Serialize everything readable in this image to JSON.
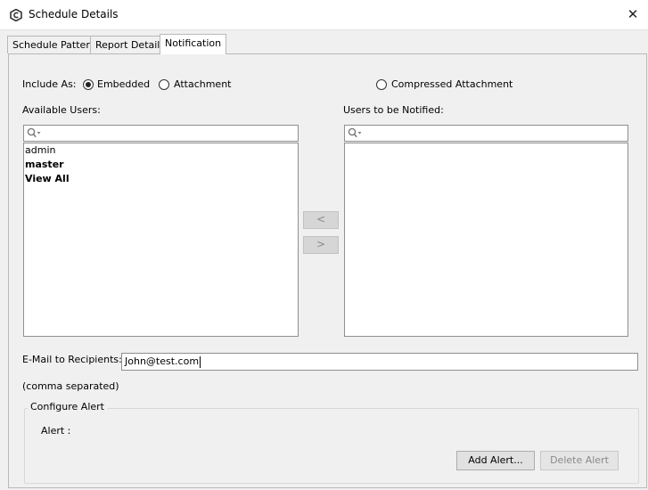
{
  "window": {
    "title": "Schedule Details",
    "close_symbol": "✕"
  },
  "tabs": [
    {
      "label": "Schedule Pattern",
      "active": false
    },
    {
      "label": "Report Details",
      "active": false
    },
    {
      "label": "Notification",
      "active": true
    }
  ],
  "include_as": {
    "label": "Include As:",
    "options": [
      {
        "label": "Embedded",
        "selected": true
      },
      {
        "label": "Attachment",
        "selected": false
      },
      {
        "label": "Compressed Attachment",
        "selected": false
      }
    ]
  },
  "available_users": {
    "label": "Available Users:",
    "items": [
      {
        "label": "admin",
        "bold": false
      },
      {
        "label": "master",
        "bold": true
      },
      {
        "label": "View All",
        "bold": true
      }
    ]
  },
  "notified_users": {
    "label": "Users to be Notified:",
    "items": []
  },
  "transfer": {
    "remove_label": "<",
    "add_label": ">"
  },
  "email": {
    "label": "E-Mail to Recipients:",
    "value": "John@test.com",
    "hint": "(comma separated)"
  },
  "alert": {
    "group_title": "Configure Alert",
    "label": "Alert :",
    "add_button": "Add Alert...",
    "delete_button": "Delete Alert"
  }
}
